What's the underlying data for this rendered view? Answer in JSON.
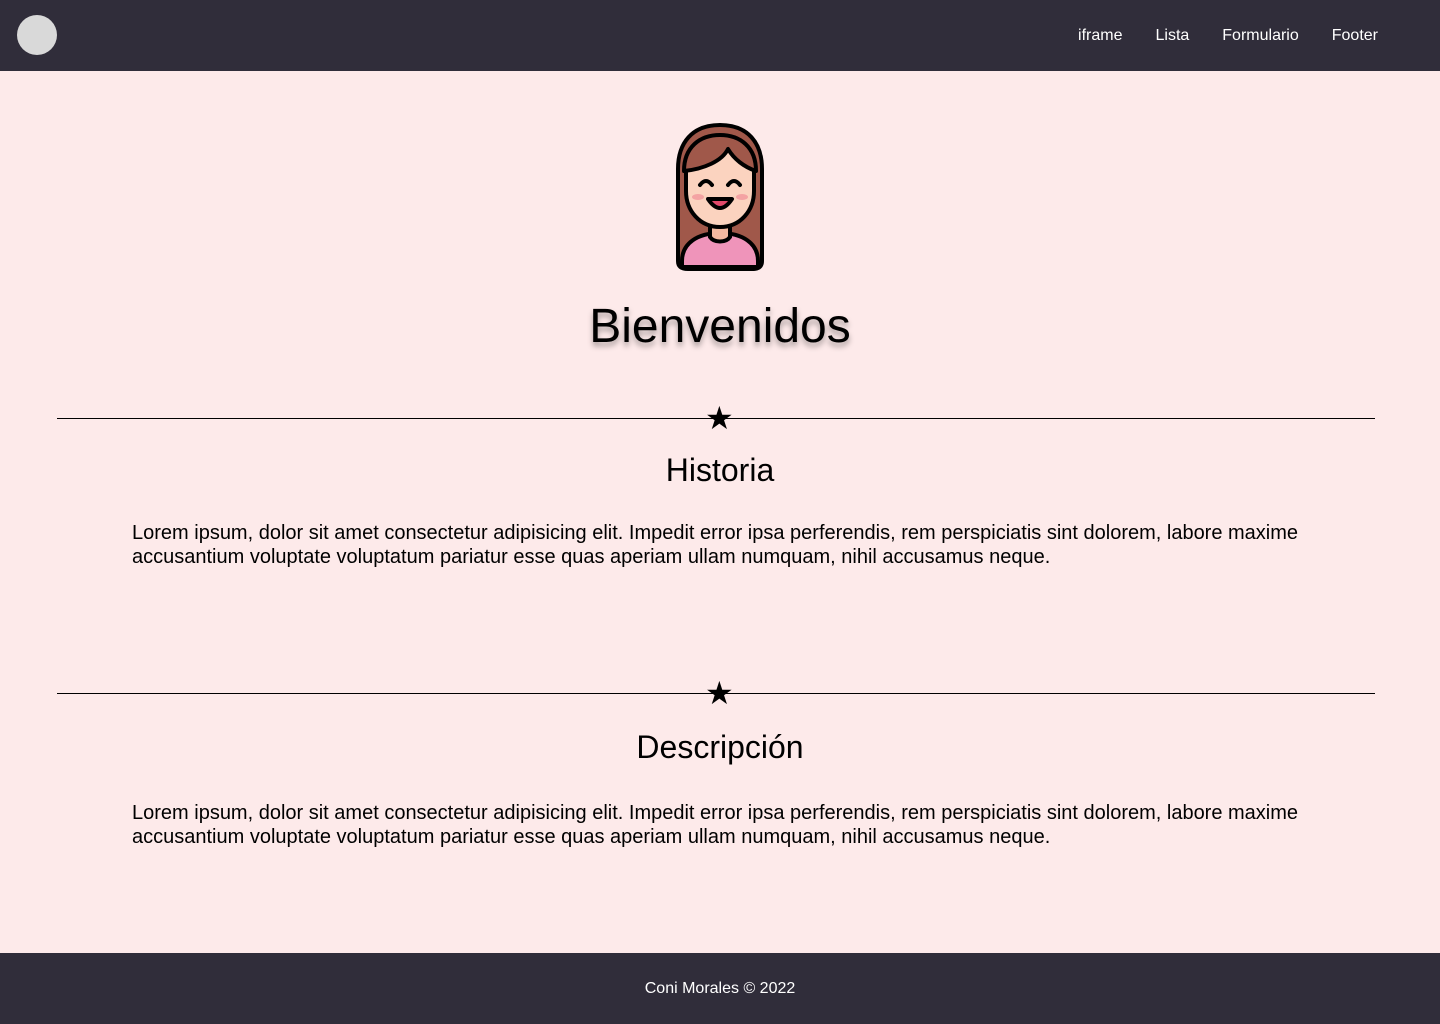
{
  "nav": {
    "logo_icon": "circle-logo",
    "links": [
      {
        "label": "iframe"
      },
      {
        "label": "Lista"
      },
      {
        "label": "Formulario"
      },
      {
        "label": "Footer"
      }
    ]
  },
  "hero": {
    "avatar_icon": "girl-avatar-icon",
    "title": "Bienvenidos"
  },
  "divider_icon": "star-icon",
  "sections": [
    {
      "title": "Historia",
      "text": "Lorem ipsum, dolor sit amet consectetur adipisicing elit. Impedit error ipsa perferendis, rem perspiciatis sint dolorem, labore maxime accusantium voluptate voluptatum pariatur esse quas aperiam ullam numquam, nihil accusamus neque."
    },
    {
      "title": "Descripción",
      "text": "Lorem ipsum, dolor sit amet consectetur adipisicing elit. Impedit error ipsa perferendis, rem perspiciatis sint dolorem, labore maxime accusantium voluptate voluptatum pariatur esse quas aperiam ullam numquam, nihil accusamus neque."
    }
  ],
  "footer": {
    "text": "Coni Morales © 2022"
  },
  "colors": {
    "nav_bg": "#302d3a",
    "page_bg": "#fdeaea",
    "text": "#000000",
    "nav_text": "#ffffff"
  }
}
